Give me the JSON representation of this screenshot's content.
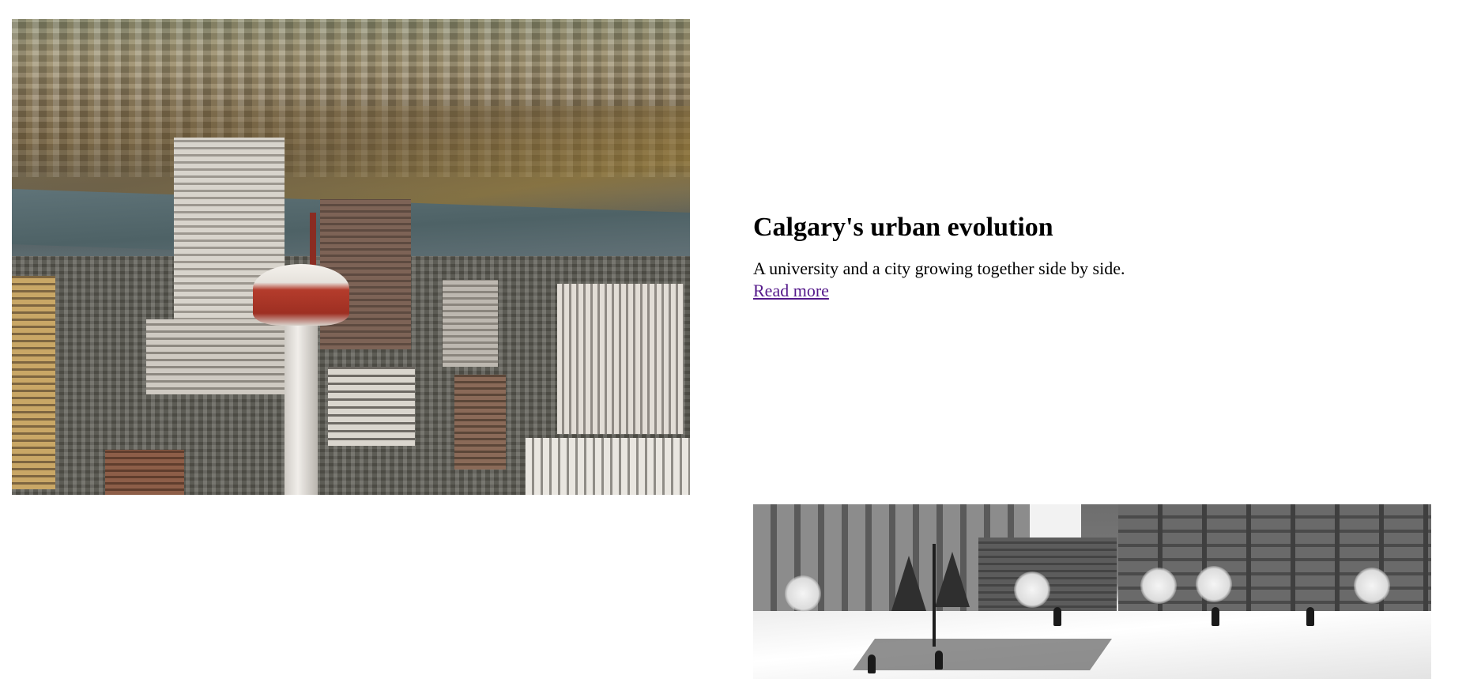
{
  "story": {
    "heading": "Calgary's urban evolution",
    "description": "A university and a city growing together side by side.",
    "link_label": "Read more"
  },
  "images": [
    {
      "name": "aerial-city-photo",
      "subject": "aerial view of a downtown skyline with an observation tower beside a river"
    },
    {
      "name": "campus-winter-photo",
      "subject": "black and white photo of a snowy university campus with buildings and people walking"
    }
  ],
  "colors": {
    "background": "#ffffff",
    "text": "#000000",
    "visited_link": "#551a8b"
  }
}
